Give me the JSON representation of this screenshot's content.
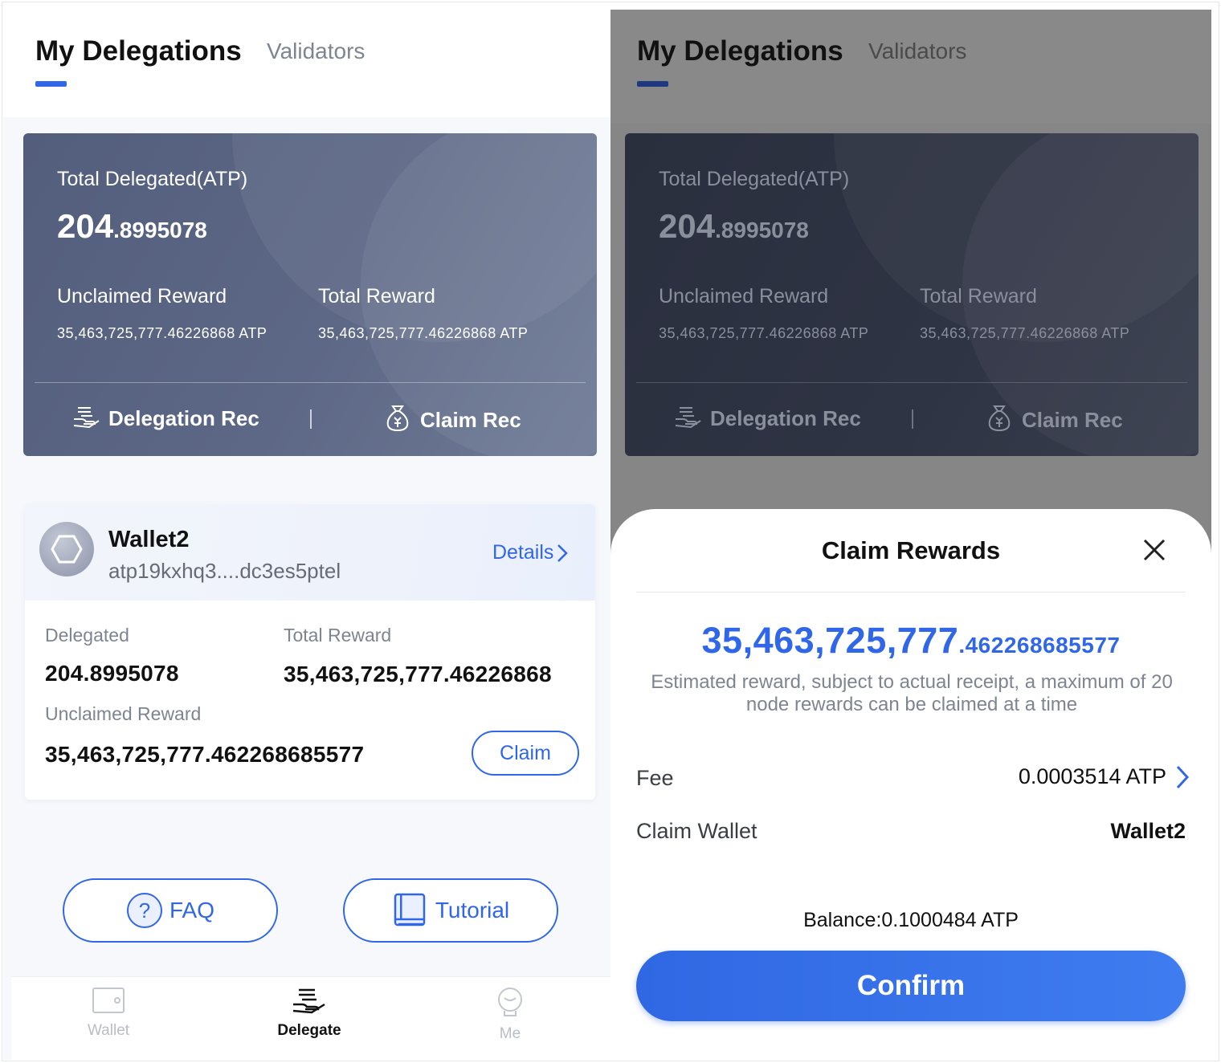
{
  "left": {
    "tabs": {
      "active": "My Delegations",
      "inactive": "Validators"
    },
    "summary": {
      "total_label": "Total Delegated(ATP)",
      "total_int": "204",
      "total_dec": ".8995078",
      "unclaimed_label": "Unclaimed Reward",
      "unclaimed_value": "35,463,725,777.46226868 ATP",
      "total_reward_label": "Total Reward",
      "total_reward_value": "35,463,725,777.46226868 ATP",
      "delegation_rec": "Delegation Rec",
      "claim_rec": "Claim Rec"
    },
    "wallet": {
      "name": "Wallet2",
      "address": "atp19kxhq3....dc3es5ptel",
      "details": "Details",
      "delegated_label": "Delegated",
      "delegated_value": "204.8995078",
      "total_reward_label": "Total Reward",
      "total_reward_value": "35,463,725,777.46226868",
      "unclaimed_label": "Unclaimed Reward",
      "unclaimed_value": "35,463,725,777.462268685577",
      "claim": "Claim"
    },
    "faq": "FAQ",
    "tutorial": "Tutorial",
    "nav": {
      "wallet": "Wallet",
      "delegate": "Delegate",
      "me": "Me",
      "active": "delegate"
    }
  },
  "right": {
    "tabs": {
      "active": "My Delegations",
      "inactive": "Validators"
    },
    "summary": {
      "total_label": "Total Delegated(ATP)",
      "total_int": "204",
      "total_dec": ".8995078",
      "unclaimed_label": "Unclaimed Reward",
      "unclaimed_value": "35,463,725,777.46226868 ATP",
      "total_reward_label": "Total Reward",
      "total_reward_value": "35,463,725,777.46226868 ATP",
      "delegation_rec": "Delegation Rec",
      "claim_rec": "Claim Rec"
    },
    "sheet": {
      "title": "Claim Rewards",
      "amount_int": "35,463,725,777",
      "amount_dec": ".462268685577",
      "note": "Estimated reward, subject to actual receipt, a maximum of 20 node rewards can be claimed at a time",
      "fee_label": "Fee",
      "fee_value": "0.0003514 ATP",
      "claim_wallet_label": "Claim Wallet",
      "claim_wallet_value": "Wallet2",
      "balance": "Balance:0.1000484 ATP",
      "confirm": "Confirm"
    }
  },
  "colors": {
    "accent": "#3067e8",
    "card": "#5d6886",
    "overlay": "#868686"
  }
}
